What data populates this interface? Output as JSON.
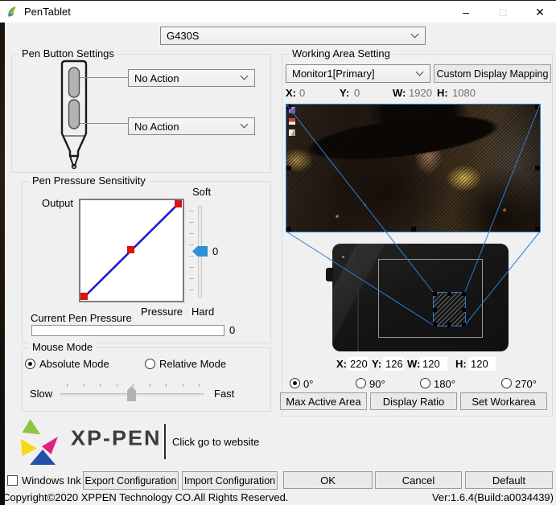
{
  "window": {
    "title": "PenTablet"
  },
  "titlebar_icons": {
    "minimize": "–",
    "maximize": "□",
    "close": "✕"
  },
  "model_selector": {
    "value": "G430S"
  },
  "pen_buttons": {
    "title": "Pen Button Settings",
    "upper_action": "No Action",
    "lower_action": "No Action"
  },
  "pressure": {
    "title": "Pen Pressure Sensitivity",
    "output_label": "Output",
    "pressure_label": "Pressure",
    "soft_label": "Soft",
    "hard_label": "Hard",
    "sensitivity_value": "0",
    "current_title": "Current Pen Pressure",
    "current_value": "0"
  },
  "mouse_mode": {
    "title": "Mouse Mode",
    "absolute": "Absolute Mode",
    "relative": "Relative Mode",
    "slow": "Slow",
    "fast": "Fast"
  },
  "brand": {
    "name": "XP-PEN",
    "tagline": "Click go to website"
  },
  "working_area": {
    "title": "Working Area Setting",
    "monitor": "Monitor1[Primary]",
    "custom_mapping": "Custom Display Mapping",
    "screen": {
      "x_label": "X:",
      "x": "0",
      "y_label": "Y:",
      "y": "0",
      "w_label": "W:",
      "w": "1920",
      "h_label": "H:",
      "h": "1080"
    },
    "tablet": {
      "x_label": "X:",
      "x": "220",
      "y_label": "Y:",
      "y": "126",
      "w_label": "W:",
      "w": "120",
      "h_label": "H:",
      "h": "120"
    },
    "rotations": [
      {
        "label": "0°"
      },
      {
        "label": "90°"
      },
      {
        "label": "180°"
      },
      {
        "label": "270°"
      }
    ],
    "selected_rotation": "0°",
    "actions": {
      "max_active": "Max Active Area",
      "display_ratio": "Display Ratio",
      "set_workarea": "Set Workarea"
    }
  },
  "footer": {
    "windows_ink": "Windows Ink",
    "export": "Export Configuration",
    "import": "Import Configuration",
    "ok": "OK",
    "cancel": "Cancel",
    "default": "Default",
    "copyright": "Copyright©2020  XPPEN Technology CO.All Rights Reserved.",
    "version": "Ver:1.6.4(Build:a0034439)"
  },
  "colors": {
    "accent": "#2e7fd0",
    "curve": "#1a1ad0",
    "control_point": "#dd1111",
    "slider_thumb": "#2f90d5"
  }
}
